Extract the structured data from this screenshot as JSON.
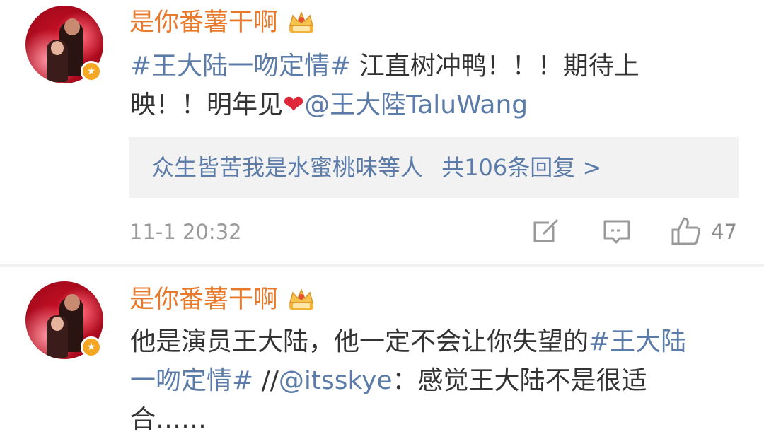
{
  "comments": [
    {
      "username": "是你番薯干啊",
      "text": {
        "topic": "#王大陆一吻定情#",
        "line1_rest": " 江直树冲鸭！！！期待上",
        "line2_start": "映！！明年见",
        "heart": "❤",
        "mention": "@王大陸TaluWang"
      },
      "reply_summary": {
        "users": "众生皆苦我是水蜜桃味等人",
        "count": "共106条回复 >"
      },
      "time": "11-1 20:32",
      "actions": {
        "forward_icon": "share-icon",
        "comment_icon": "comment-icon",
        "like_icon": "thumbs-up-icon"
      },
      "like_count": "47"
    },
    {
      "username": "是你番薯干啊",
      "text": {
        "line1_start": "他是演员王大陆，他一定不会让你失望的",
        "topic_part1": "#王大陆",
        "topic_part2": "一吻定情#",
        "repost_prefix": " //",
        "mention": "@itsskye",
        "repost_rest": "：感觉王大陆不是很适",
        "line3": "合……"
      }
    }
  ],
  "colors": {
    "username": "#e9792a",
    "link": "#5b7ba8",
    "text": "#333333",
    "meta": "#9a9a9a",
    "reply_bg": "#f2f2f2",
    "heart": "#e0283a"
  }
}
